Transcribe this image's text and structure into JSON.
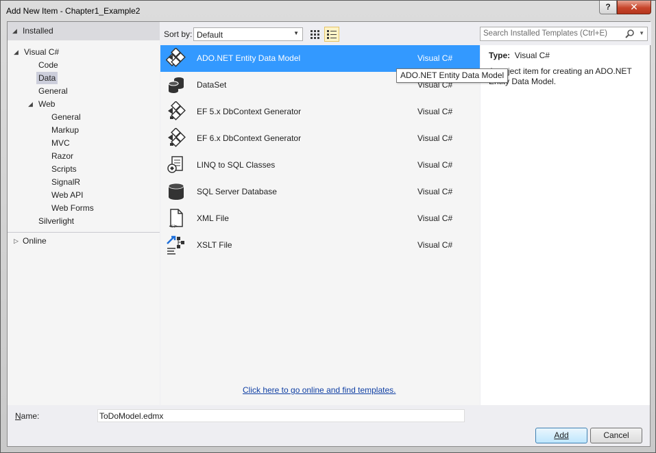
{
  "window": {
    "title": "Add New Item - Chapter1_Example2",
    "help_glyph": "?",
    "close_glyph": "✕"
  },
  "left": {
    "installed_label": "Installed",
    "tree": [
      {
        "label": "Visual C#",
        "level": 1,
        "expander": "◢"
      },
      {
        "label": "Code",
        "level": 2
      },
      {
        "label": "Data",
        "level": 2,
        "selected": true
      },
      {
        "label": "General",
        "level": 2
      },
      {
        "label": "Web",
        "level": 2,
        "expander": "◢"
      },
      {
        "label": "General",
        "level": 3
      },
      {
        "label": "Markup",
        "level": 3
      },
      {
        "label": "MVC",
        "level": 3
      },
      {
        "label": "Razor",
        "level": 3
      },
      {
        "label": "Scripts",
        "level": 3
      },
      {
        "label": "SignalR",
        "level": 3
      },
      {
        "label": "Web API",
        "level": 3
      },
      {
        "label": "Web Forms",
        "level": 3
      },
      {
        "label": "Silverlight",
        "level": 2
      }
    ],
    "online_label": "Online"
  },
  "toolbar": {
    "sort_label": "Sort by:",
    "sort_value": "Default",
    "search_placeholder": "Search Installed Templates (Ctrl+E)"
  },
  "templates": [
    {
      "name": "ADO.NET Entity Data Model",
      "lang": "Visual C#",
      "icon": "entity-model-icon",
      "selected": true
    },
    {
      "name": "DataSet",
      "lang": "Visual C#",
      "icon": "dataset-icon"
    },
    {
      "name": "EF 5.x DbContext Generator",
      "lang": "Visual C#",
      "icon": "ef-generator-icon"
    },
    {
      "name": "EF 6.x DbContext Generator",
      "lang": "Visual C#",
      "icon": "ef-generator-icon"
    },
    {
      "name": "LINQ to SQL Classes",
      "lang": "Visual C#",
      "icon": "linq-to-sql-icon"
    },
    {
      "name": "SQL Server Database",
      "lang": "Visual C#",
      "icon": "database-icon"
    },
    {
      "name": "XML File",
      "lang": "Visual C#",
      "icon": "xml-file-icon"
    },
    {
      "name": "XSLT File",
      "lang": "Visual C#",
      "icon": "xslt-file-icon"
    }
  ],
  "online_link": "Click here to go online and find templates.",
  "tooltip": "ADO.NET Entity Data Model",
  "detail": {
    "type_label": "Type:",
    "type_value": "Visual C#",
    "description": "A project item for creating an ADO.NET Entity Data Model."
  },
  "bottom": {
    "name_label": "Name:",
    "name_value": "ToDoModel.edmx",
    "add_label": "Add",
    "cancel_label": "Cancel"
  },
  "colors": {
    "selection": "#3399ff",
    "tree_selection": "#cccedb",
    "link": "#0e3ea3"
  }
}
